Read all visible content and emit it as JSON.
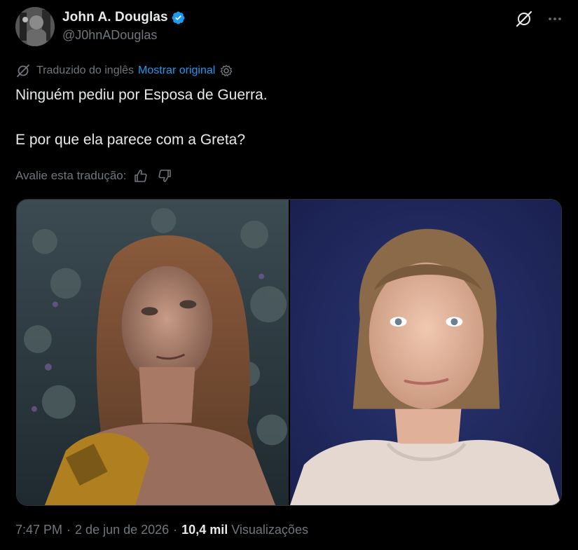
{
  "author": {
    "display_name": "John A. Douglas",
    "handle": "@J0hnADouglas",
    "verified": true
  },
  "translation": {
    "notice": "Traduzido do inglês",
    "show_original": "Mostrar original"
  },
  "tweet": {
    "line1": "Ninguém pediu por Esposa de Guerra.",
    "line2": "E por que ela parece com a Greta?"
  },
  "rate": {
    "label": "Avalie esta tradução:"
  },
  "footer": {
    "time": "7:47 PM",
    "date": "2 de jun de 2026",
    "views_count": "10,4 mil",
    "views_label": "Visualizações"
  },
  "colors": {
    "background": "#000000",
    "text": "#e7e9ea",
    "muted": "#71767b",
    "link": "#1d9bf0",
    "verified": "#1d9bf0"
  },
  "icons": {
    "grok": "grok-icon",
    "more": "more-icon",
    "translate": "translate-icon",
    "settings": "gear-icon",
    "thumbs_up": "thumbs-up-icon",
    "thumbs_down": "thumbs-down-icon"
  }
}
